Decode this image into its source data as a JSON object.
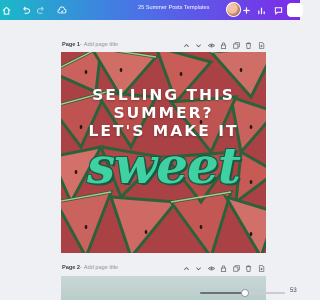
{
  "app": {
    "title": "25 Summer Posts Templates"
  },
  "colors": {
    "topbar_start": "#19b9c7",
    "topbar_end": "#7d2ae8",
    "sweet_text": "#3fd1a2"
  },
  "pages": [
    {
      "label": "Page 1",
      "separator": " - ",
      "title_placeholder": "Add page title"
    },
    {
      "label": "Page 2",
      "separator": " - ",
      "title_placeholder": "Add page title"
    }
  ],
  "design": {
    "headline_line1": "SELLING THIS",
    "headline_line2": "SUMMER?",
    "headline_line3": "LET'S MAKE IT",
    "script_word": "sweet"
  },
  "zoom": {
    "level": "53",
    "fraction": 0.53
  },
  "icons": {
    "topbar": [
      "home-icon",
      "undo-icon",
      "redo-icon",
      "cloud-sync-icon",
      "add-icon",
      "analytics-icon",
      "comment-icon"
    ],
    "page_header": [
      "chevron-up-icon",
      "chevron-down-icon",
      "eye-icon",
      "lock-icon",
      "duplicate-icon",
      "trash-icon",
      "add-page-icon"
    ]
  }
}
